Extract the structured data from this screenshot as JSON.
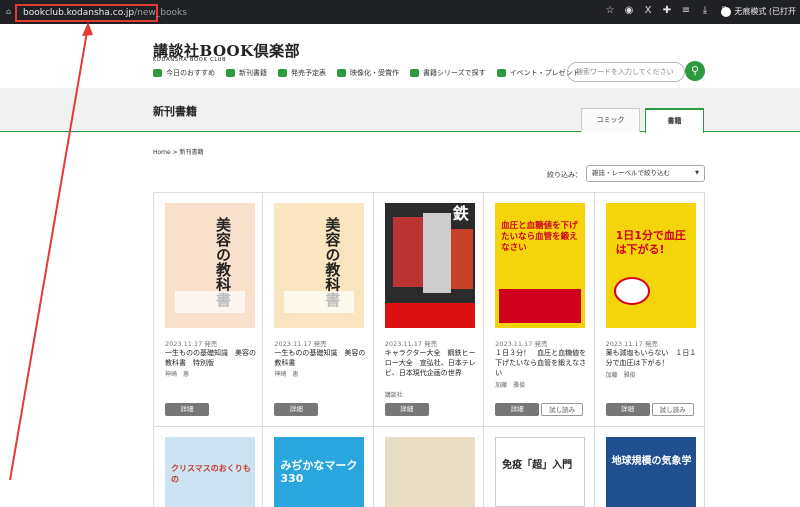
{
  "browser": {
    "url_host": "bookclub.kodansha.co.jp",
    "url_path": "/new_books",
    "profile": "无痕模式 (已打开"
  },
  "header": {
    "logo": "講談社BOOK倶楽部",
    "logo_sub": "KODANSHA BOOK CLUB",
    "nav": [
      "今日のおすすめ",
      "新刊書籍",
      "発売予定表",
      "映像化・受賞作",
      "書籍シリーズで探す",
      "イベント・プレゼント"
    ],
    "search_placeholder": "検索ワードを入力してください"
  },
  "page": {
    "title": "新刊書籍",
    "tabs": [
      "コミック",
      "書籍"
    ],
    "breadcrumb": "Home  >  新刊書籍",
    "filter_label": "絞り込み：",
    "filter_value": "雑誌・レーベルで絞り込む"
  },
  "buttons": {
    "detail": "詳細",
    "trial": "試し読み"
  },
  "books": [
    {
      "date": "2023.11.17 発売",
      "title": "一生ものの基礎知識　美容の教科書　特別版",
      "author": "神崎　恵",
      "cover_text": "美容の教科書",
      "cover_color": "#f7e0cc"
    },
    {
      "date": "2023.11.17 発売",
      "title": "一生ものの基礎知識　美容の教科書",
      "author": "神崎　恵",
      "cover_text": "美容の教科書",
      "cover_color": "#f9e6c0"
    },
    {
      "date": "2023.11.17 発売",
      "title": "キャラクター大全　鋼鉄ヒーロー大全　宣弘社、日本テレビ、日本現代企画の世界",
      "author": "講談社",
      "cover_text": "鉄",
      "cover_color": "#2b2b2b"
    },
    {
      "date": "2023.11.17 発売",
      "title": "１日３分！　血圧と血糖値を下げたいなら血管を鍛えなさい",
      "author": "加藤　雅俊",
      "cover_text": "血圧と血糖値を下げたいなら血管を鍛えなさい",
      "cover_color": "#f4d40b"
    },
    {
      "date": "2023.11.17 発売",
      "title": "薬も減塩もいらない　１日１分で血圧は下がる！",
      "author": "加藤　雅俊",
      "cover_text": "1日1分で血圧は下がる!",
      "cover_color": "#f4d40b"
    }
  ],
  "books_row2": [
    {
      "cover_text": "クリスマスのおくりもの",
      "cover_color": "#cde3f2"
    },
    {
      "cover_text": "みぢかなマーク330",
      "cover_color": "#2aa6de"
    },
    {
      "cover_text": "",
      "cover_color": "#e9dcc4"
    },
    {
      "cover_text": "免疫「超」入門",
      "cover_color": "#ffffff"
    },
    {
      "cover_text": "地球規模の気象学",
      "cover_color": "#1f4f8f"
    }
  ]
}
